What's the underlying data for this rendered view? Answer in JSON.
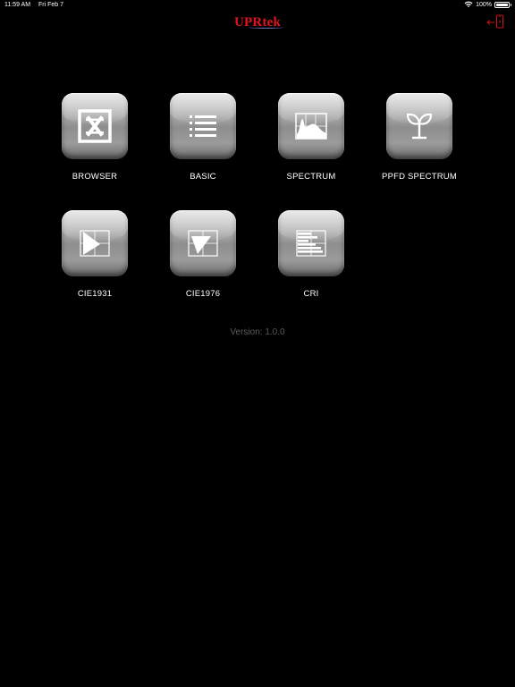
{
  "status_bar": {
    "time": "11:59 AM",
    "date": "Fri Feb 7",
    "battery": "100%",
    "icons": [
      "wifi-icon",
      "battery-icon"
    ]
  },
  "header": {
    "logo": "UPRtek",
    "logo_color": "#e0141e",
    "exit_icon": "exit-phone-icon"
  },
  "apps": [
    {
      "label": "BROWSER",
      "icon": "browser-icon"
    },
    {
      "label": "BASIC",
      "icon": "list-icon"
    },
    {
      "label": "SPECTRUM",
      "icon": "spectrum-icon"
    },
    {
      "label": "PPFD SPECTRUM",
      "icon": "plant-sprout-icon"
    },
    {
      "label": "CIE1931",
      "icon": "cie1931-icon"
    },
    {
      "label": "CIE1976",
      "icon": "cie1976-icon"
    },
    {
      "label": "CRI",
      "icon": "cri-bars-icon"
    }
  ],
  "footer": {
    "version": "Version: 1.0.0"
  }
}
